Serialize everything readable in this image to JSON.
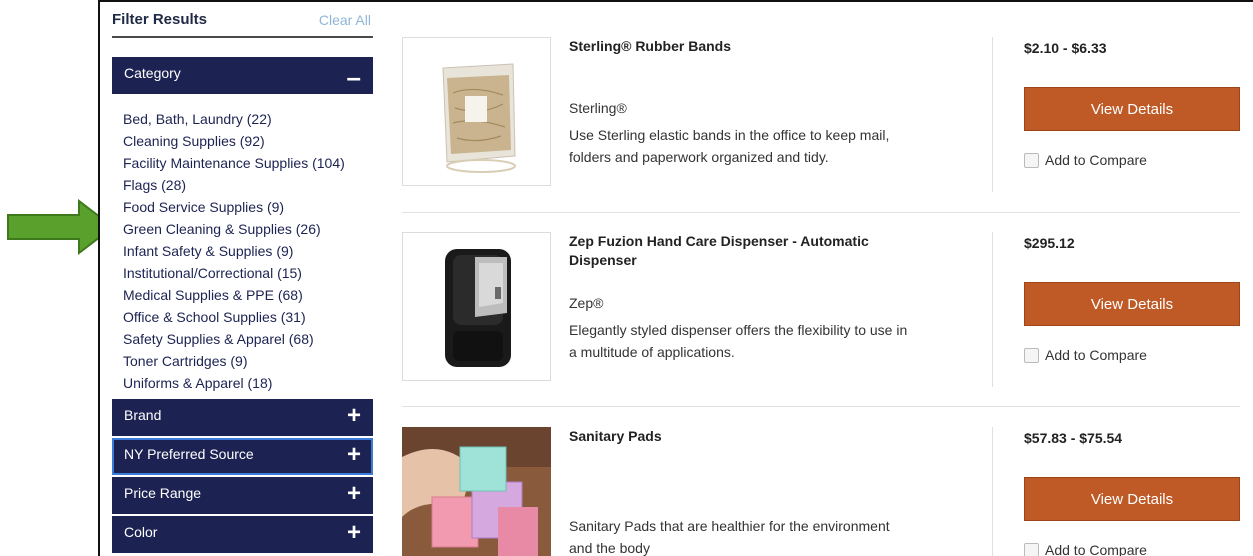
{
  "sidebar": {
    "title": "Filter Results",
    "clear_all": "Clear All",
    "category_label": "Category",
    "category_toggle": "–",
    "categories": [
      "Bed, Bath, Laundry (22)",
      "Cleaning Supplies (92)",
      "Facility Maintenance Supplies (104)",
      "Flags (28)",
      "Food Service Supplies (9)",
      "Green Cleaning & Supplies (26)",
      "Infant Safety & Supplies (9)",
      "Institutional/Correctional (15)",
      "Medical Supplies & PPE (68)",
      "Office & School Supplies (31)",
      "Safety Supplies & Apparel (68)",
      "Toner Cartridges (9)",
      "Uniforms & Apparel (18)"
    ],
    "facets": [
      {
        "label": "Brand",
        "toggle": "+"
      },
      {
        "label": "NY Preferred Source",
        "toggle": "+"
      },
      {
        "label": "Price Range",
        "toggle": "+"
      },
      {
        "label": "Color",
        "toggle": "+"
      }
    ]
  },
  "products": [
    {
      "title": "Sterling® Rubber Bands",
      "brand": "Sterling®",
      "description": "Use Sterling elastic bands in the office to keep mail, folders and paperwork organized and tidy.",
      "price": "$2.10 - $6.33",
      "button": "View Details",
      "compare": "Add to Compare"
    },
    {
      "title": "Zep Fuzion Hand Care Dispenser - Automatic Dispenser",
      "brand": "Zep®",
      "description": "Elegantly styled dispenser offers the flexibility to use in a multitude of applications.",
      "price": "$295.12",
      "button": "View Details",
      "compare": "Add to Compare"
    },
    {
      "title": "Sanitary Pads",
      "brand": "",
      "description": "Sanitary Pads that are healthier for the environment and the body",
      "price": "$57.83 - $75.54",
      "button": "View Details",
      "compare": "Add to Compare"
    }
  ],
  "colors": {
    "facet_bar": "#1c2352",
    "button": "#bf5a26",
    "arrow": "#5aa02c",
    "link": "#8fb6d9"
  },
  "icons": {
    "annotation": "green-right-arrow-icon"
  }
}
